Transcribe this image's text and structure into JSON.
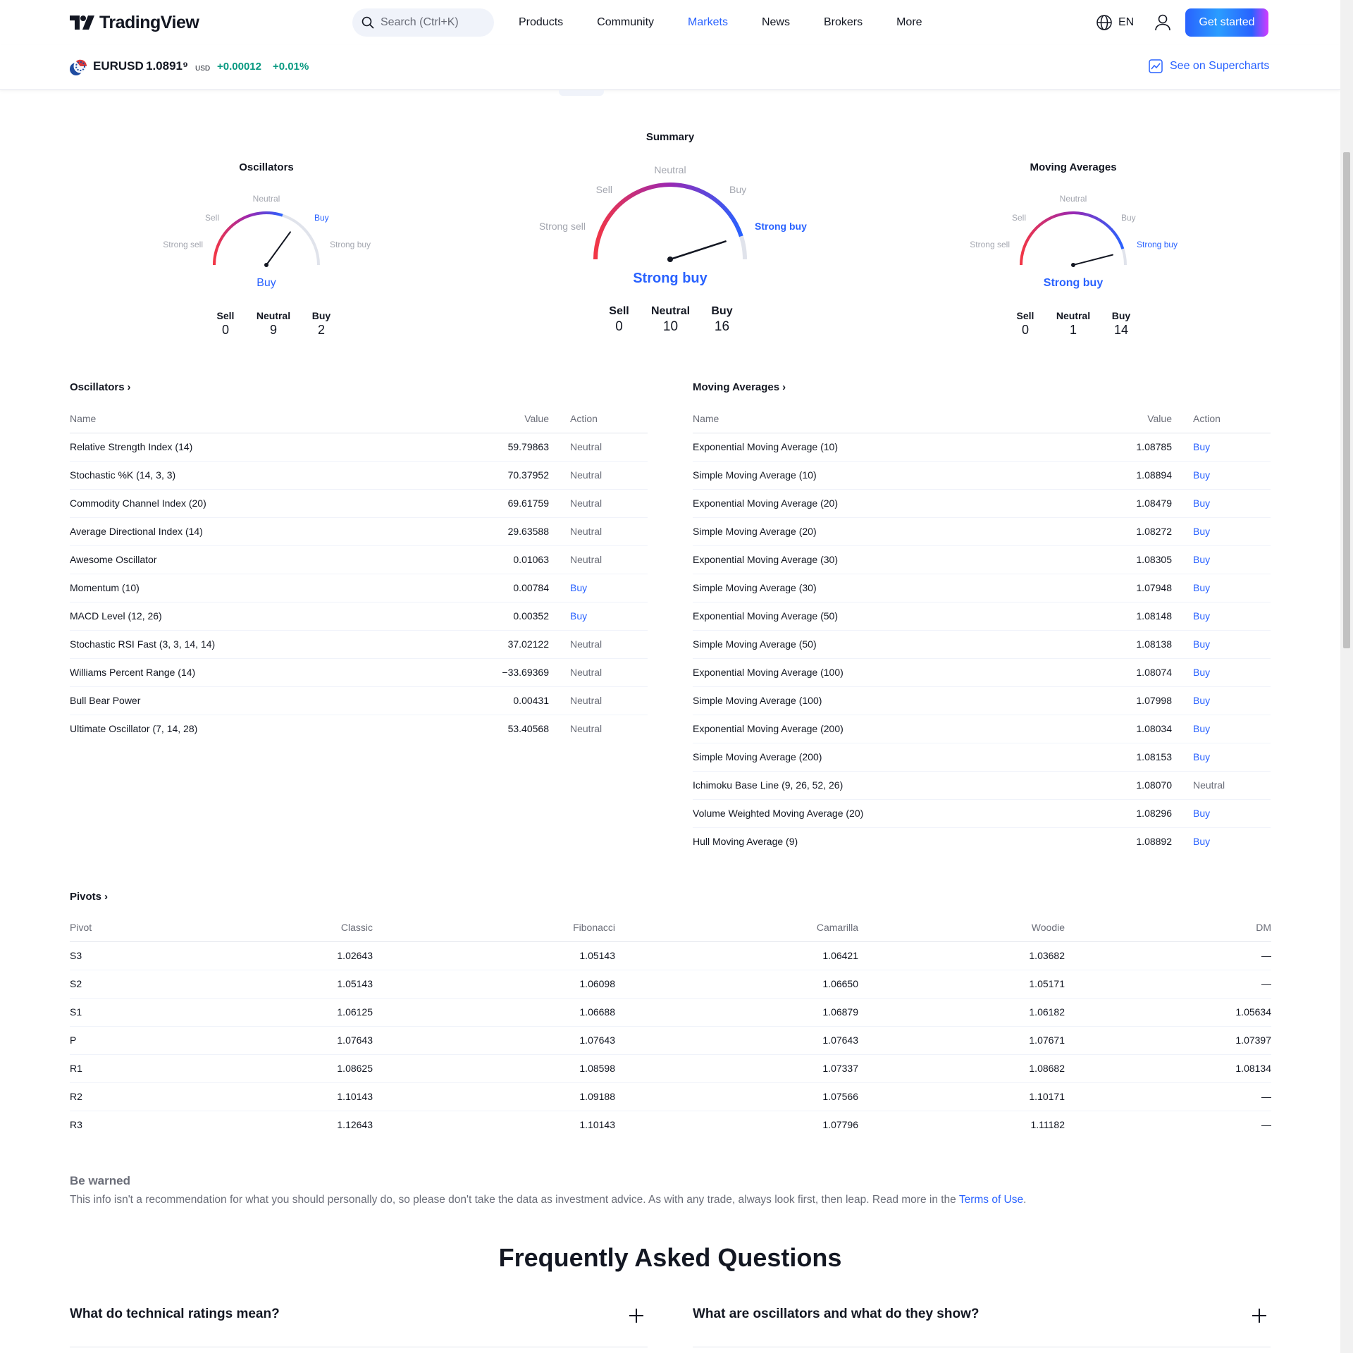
{
  "header": {
    "brand": "TradingView",
    "search_placeholder": "Search (Ctrl+K)",
    "nav": [
      "Products",
      "Community",
      "Markets",
      "News",
      "Brokers",
      "More"
    ],
    "nav_active": "Markets",
    "lang": "EN",
    "cta": "Get started"
  },
  "symbol": {
    "name": "EURUSD",
    "price": "1.0891⁹",
    "currency": "USD",
    "change": "+0.00012",
    "change_pct": "+0.01%",
    "supercharts": "See on Supercharts"
  },
  "gauges": {
    "oscillators": {
      "title": "Oscillators",
      "labels": {
        "strong_sell": "Strong sell",
        "sell": "Sell",
        "neutral": "Neutral",
        "buy": "Buy",
        "strong_buy": "Strong buy"
      },
      "result": "Buy",
      "active": "buy",
      "needle_value": 0.7,
      "counts": [
        {
          "label": "Sell",
          "value": "0"
        },
        {
          "label": "Neutral",
          "value": "9"
        },
        {
          "label": "Buy",
          "value": "2"
        }
      ]
    },
    "summary": {
      "title": "Summary",
      "labels": {
        "strong_sell": "Strong sell",
        "sell": "Sell",
        "neutral": "Neutral",
        "buy": "Buy",
        "strong_buy": "Strong buy"
      },
      "result": "Strong buy",
      "active": "strong_buy",
      "needle_value": 0.9,
      "counts": [
        {
          "label": "Sell",
          "value": "0"
        },
        {
          "label": "Neutral",
          "value": "10"
        },
        {
          "label": "Buy",
          "value": "16"
        }
      ]
    },
    "moving_averages": {
      "title": "Moving Averages",
      "labels": {
        "strong_sell": "Strong sell",
        "sell": "Sell",
        "neutral": "Neutral",
        "buy": "Buy",
        "strong_buy": "Strong buy"
      },
      "result": "Strong buy",
      "active": "strong_buy",
      "needle_value": 0.92,
      "counts": [
        {
          "label": "Sell",
          "value": "0"
        },
        {
          "label": "Neutral",
          "value": "1"
        },
        {
          "label": "Buy",
          "value": "14"
        }
      ]
    }
  },
  "oscillators_table": {
    "title": "Oscillators",
    "columns": [
      "Name",
      "Value",
      "Action"
    ],
    "rows": [
      {
        "name": "Relative Strength Index (14)",
        "value": "59.79863",
        "action": "Neutral"
      },
      {
        "name": "Stochastic %K (14, 3, 3)",
        "value": "70.37952",
        "action": "Neutral"
      },
      {
        "name": "Commodity Channel Index (20)",
        "value": "69.61759",
        "action": "Neutral"
      },
      {
        "name": "Average Directional Index (14)",
        "value": "29.63588",
        "action": "Neutral"
      },
      {
        "name": "Awesome Oscillator",
        "value": "0.01063",
        "action": "Neutral"
      },
      {
        "name": "Momentum (10)",
        "value": "0.00784",
        "action": "Buy"
      },
      {
        "name": "MACD Level (12, 26)",
        "value": "0.00352",
        "action": "Buy"
      },
      {
        "name": "Stochastic RSI Fast (3, 3, 14, 14)",
        "value": "37.02122",
        "action": "Neutral"
      },
      {
        "name": "Williams Percent Range (14)",
        "value": "−33.69369",
        "action": "Neutral"
      },
      {
        "name": "Bull Bear Power",
        "value": "0.00431",
        "action": "Neutral"
      },
      {
        "name": "Ultimate Oscillator (7, 14, 28)",
        "value": "53.40568",
        "action": "Neutral"
      }
    ]
  },
  "ma_table": {
    "title": "Moving Averages",
    "columns": [
      "Name",
      "Value",
      "Action"
    ],
    "rows": [
      {
        "name": "Exponential Moving Average (10)",
        "value": "1.08785",
        "action": "Buy"
      },
      {
        "name": "Simple Moving Average (10)",
        "value": "1.08894",
        "action": "Buy"
      },
      {
        "name": "Exponential Moving Average (20)",
        "value": "1.08479",
        "action": "Buy"
      },
      {
        "name": "Simple Moving Average (20)",
        "value": "1.08272",
        "action": "Buy"
      },
      {
        "name": "Exponential Moving Average (30)",
        "value": "1.08305",
        "action": "Buy"
      },
      {
        "name": "Simple Moving Average (30)",
        "value": "1.07948",
        "action": "Buy"
      },
      {
        "name": "Exponential Moving Average (50)",
        "value": "1.08148",
        "action": "Buy"
      },
      {
        "name": "Simple Moving Average (50)",
        "value": "1.08138",
        "action": "Buy"
      },
      {
        "name": "Exponential Moving Average (100)",
        "value": "1.08074",
        "action": "Buy"
      },
      {
        "name": "Simple Moving Average (100)",
        "value": "1.07998",
        "action": "Buy"
      },
      {
        "name": "Exponential Moving Average (200)",
        "value": "1.08034",
        "action": "Buy"
      },
      {
        "name": "Simple Moving Average (200)",
        "value": "1.08153",
        "action": "Buy"
      },
      {
        "name": "Ichimoku Base Line (9, 26, 52, 26)",
        "value": "1.08070",
        "action": "Neutral"
      },
      {
        "name": "Volume Weighted Moving Average (20)",
        "value": "1.08296",
        "action": "Buy"
      },
      {
        "name": "Hull Moving Average (9)",
        "value": "1.08892",
        "action": "Buy"
      }
    ]
  },
  "pivots_table": {
    "title": "Pivots",
    "columns": [
      "Pivot",
      "Classic",
      "Fibonacci",
      "Camarilla",
      "Woodie",
      "DM"
    ],
    "rows": [
      [
        "S3",
        "1.02643",
        "1.05143",
        "1.06421",
        "1.03682",
        "—"
      ],
      [
        "S2",
        "1.05143",
        "1.06098",
        "1.06650",
        "1.05171",
        "—"
      ],
      [
        "S1",
        "1.06125",
        "1.06688",
        "1.06879",
        "1.06182",
        "1.05634"
      ],
      [
        "P",
        "1.07643",
        "1.07643",
        "1.07643",
        "1.07671",
        "1.07397"
      ],
      [
        "R1",
        "1.08625",
        "1.08598",
        "1.07337",
        "1.08682",
        "1.08134"
      ],
      [
        "R2",
        "1.10143",
        "1.09188",
        "1.07566",
        "1.10171",
        "—"
      ],
      [
        "R3",
        "1.12643",
        "1.10143",
        "1.07796",
        "1.11182",
        "—"
      ]
    ]
  },
  "warning": {
    "title": "Be warned",
    "text": "This info isn't a recommendation for what you should personally do, so please don't take the data as investment advice. As with any trade, always look first, then leap. Read more in the ",
    "link": "Terms of Use",
    "end": "."
  },
  "faq": {
    "title": "Frequently Asked Questions",
    "questions": [
      "What do technical ratings mean?",
      "What are oscillators and what do they show?"
    ]
  },
  "colors": {
    "accent": "#2962ff",
    "positive": "#089981",
    "sell": "#f23645",
    "muted": "#6a6d78"
  }
}
